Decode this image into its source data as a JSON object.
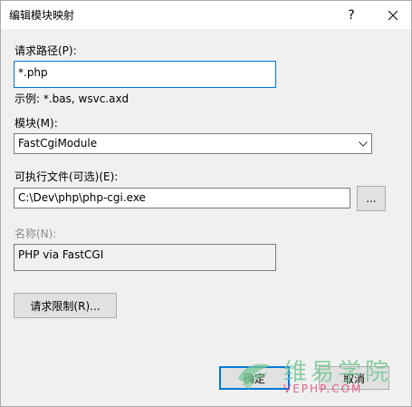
{
  "window": {
    "title": "编辑模块映射",
    "help_glyph": "?",
    "close_glyph": "✕"
  },
  "request_path": {
    "label": "请求路径(P):",
    "value": "*.php",
    "example": "示例: *.bas, wsvc.axd"
  },
  "module": {
    "label": "模块(M):",
    "selected": "FastCgiModule"
  },
  "executable": {
    "label": "可执行文件(可选)(E):",
    "value": "C:\\Dev\\php\\php-cgi.exe",
    "browse_label": "..."
  },
  "name": {
    "label": "名称(N):",
    "value": "PHP via FastCGI"
  },
  "buttons": {
    "restrictions": "请求限制(R)...",
    "ok": "确定",
    "cancel": "取消"
  },
  "watermark": {
    "cn": "维易学院",
    "en": "VEPHP.COM",
    "colors": {
      "green": "#78c896",
      "pink": "#e64678"
    }
  },
  "colors": {
    "focus_blue": "#0078d7",
    "dialog_bg": "#f0f0f0",
    "disabled_text": "#8b8b8b"
  }
}
